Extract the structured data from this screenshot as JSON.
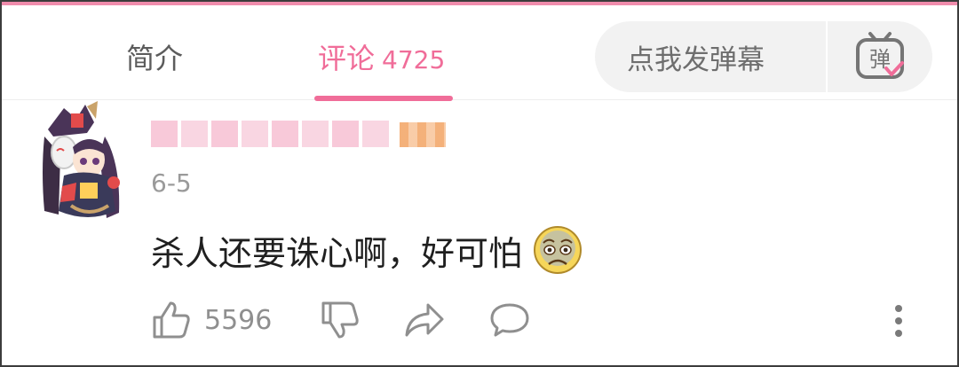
{
  "tabs": {
    "intro_label": "简介",
    "comments_label": "评论",
    "comments_count": "4725"
  },
  "danmaku": {
    "placeholder": "点我发弹幕",
    "button_icon_text": "弹"
  },
  "comment": {
    "date": "6-5",
    "text": "杀人还要诛心啊，好可怕",
    "emoji": "fearful-face-emoji",
    "like_count": "5596"
  },
  "colors": {
    "accent": "#f06d99",
    "text_secondary": "#9a9a9a"
  }
}
